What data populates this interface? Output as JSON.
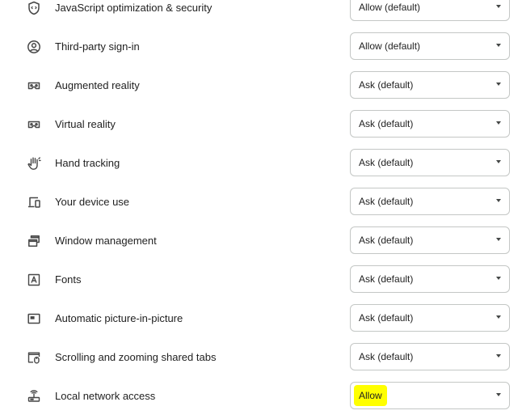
{
  "permissions": [
    {
      "label": "JavaScript optimization & security",
      "icon": "shield-code-icon",
      "value": "Allow (default)",
      "highlighted": false
    },
    {
      "label": "Third-party sign-in",
      "icon": "account-circle-icon",
      "value": "Allow (default)",
      "highlighted": false
    },
    {
      "label": "Augmented reality",
      "icon": "vr-headset-icon",
      "value": "Ask (default)",
      "highlighted": false
    },
    {
      "label": "Virtual reality",
      "icon": "vr-headset-icon",
      "value": "Ask (default)",
      "highlighted": false
    },
    {
      "label": "Hand tracking",
      "icon": "hand-icon",
      "value": "Ask (default)",
      "highlighted": false
    },
    {
      "label": "Your device use",
      "icon": "devices-icon",
      "value": "Ask (default)",
      "highlighted": false
    },
    {
      "label": "Window management",
      "icon": "window-management-icon",
      "value": "Ask (default)",
      "highlighted": false
    },
    {
      "label": "Fonts",
      "icon": "font-icon",
      "value": "Ask (default)",
      "highlighted": false
    },
    {
      "label": "Automatic picture-in-picture",
      "icon": "picture-in-picture-icon",
      "value": "Ask (default)",
      "highlighted": false
    },
    {
      "label": "Scrolling and zooming shared tabs",
      "icon": "shared-tab-mouse-icon",
      "value": "Ask (default)",
      "highlighted": false
    },
    {
      "label": "Local network access",
      "icon": "router-icon",
      "value": "Allow",
      "highlighted": true
    }
  ],
  "colors": {
    "highlight": "#ffff00",
    "border": "#c4c7c5",
    "text": "#1f1f1f",
    "icon": "#474747"
  }
}
